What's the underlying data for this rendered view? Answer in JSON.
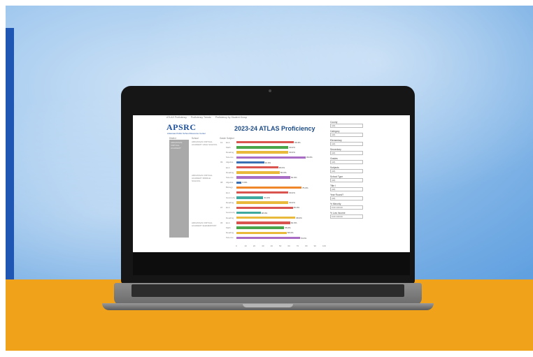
{
  "dashboard": {
    "tabs": [
      "ATLAS Proficiency",
      "Proficiency Trends",
      "Proficiency by Student Group"
    ],
    "logo": "APSRC",
    "logo_subtitle": "Arkansas Public School Resource Center",
    "title": "2023-24 ATLAS Proficiency",
    "headers": {
      "district": "District",
      "school": "School",
      "grade": "Grade",
      "subject": "Subject"
    },
    "district_name": "ARKANSAS VIRTUAL ACADEMY",
    "schools": [
      "ARKANSAS VIRTUAL ACADEMY HIGH SCHOOL",
      "ARKANSAS VIRTUAL ACADEMY MIDDLE SCHOOL",
      "ARKANSAS VIRTUAL ACADEMY ELEMENTARY"
    ],
    "filters": [
      {
        "label": "County",
        "value": "(All)"
      },
      {
        "label": "Category",
        "value": "(All)"
      },
      {
        "label": "Elementary",
        "value": "(All)"
      },
      {
        "label": "Secondary",
        "value": "(All)"
      },
      {
        "label": "Grades",
        "value": "(All)"
      },
      {
        "label": "Subjects",
        "value": "(All)"
      },
      {
        "label": "School Type",
        "value": "(All)"
      },
      {
        "label": "Title I",
        "value": "(All)"
      },
      {
        "label": "Year Round?",
        "value": "(All)"
      },
      {
        "label": "% Minority",
        "value": "0.00  100.00"
      },
      {
        "label": "% Low Income",
        "value": "0.00  100.00"
      }
    ],
    "axis_ticks": [
      "0",
      "10",
      "20",
      "30",
      "40",
      "50",
      "60",
      "70",
      "80",
      "90",
      "100"
    ]
  },
  "chart_data": {
    "type": "bar",
    "orientation": "horizontal",
    "xlim": [
      0,
      100
    ],
    "rows": [
      {
        "grade": "10",
        "subject": "ELA",
        "value": 66.3
      },
      {
        "grade": "",
        "subject": "Math",
        "value": 60.0
      },
      {
        "grade": "",
        "subject": "Reading",
        "value": 60.0
      },
      {
        "grade": "",
        "subject": "Science",
        "value": 80.0
      },
      {
        "grade": "09",
        "subject": "Algebra",
        "value": 32.0
      },
      {
        "grade": "",
        "subject": "ELA",
        "value": 48.0
      },
      {
        "grade": "",
        "subject": "Reading",
        "value": 50.0
      },
      {
        "grade": "",
        "subject": "Science",
        "value": 62.0
      },
      {
        "grade": "08",
        "subject": "Algebra",
        "value": 6.0
      },
      {
        "grade": "",
        "subject": "Biology",
        "value": 75.0
      },
      {
        "grade": "",
        "subject": "ELA",
        "value": 60.0
      },
      {
        "grade": "",
        "subject": "Geometry",
        "value": 31.0
      },
      {
        "grade": "",
        "subject": "Reading",
        "value": 60.0
      },
      {
        "grade": "07",
        "subject": "ELA",
        "value": 65.0
      },
      {
        "grade": "",
        "subject": "Geometry",
        "value": 28.0
      },
      {
        "grade": "",
        "subject": "Reading",
        "value": 68.0
      },
      {
        "grade": "06",
        "subject": "ELA",
        "value": 62.0
      },
      {
        "grade": "",
        "subject": "Math",
        "value": 55.0
      },
      {
        "grade": "",
        "subject": "Reading",
        "value": 58.0
      },
      {
        "grade": "",
        "subject": "Science",
        "value": 73.0
      }
    ],
    "colors": {
      "ELA": "#d9534f",
      "Math": "#4aa54a",
      "Reading": "#e8b93a",
      "Science": "#a86cc4",
      "Algebra": "#3b6fb4",
      "Biology": "#f0862a",
      "Geometry": "#3fa9a0"
    }
  }
}
